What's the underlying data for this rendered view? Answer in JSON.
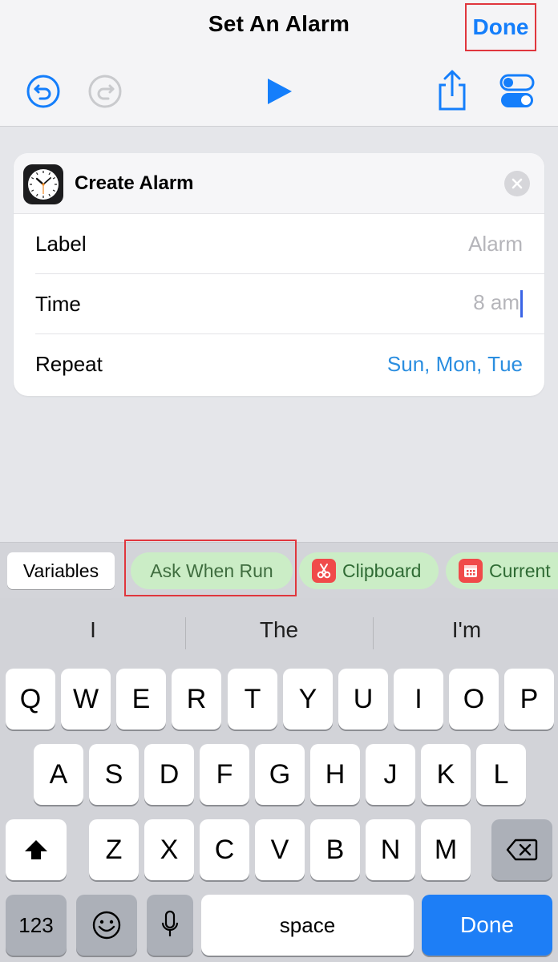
{
  "nav": {
    "title": "Set An Alarm",
    "done_label": "Done"
  },
  "toolbar": {
    "icons": [
      "undo-icon",
      "redo-icon",
      "play-icon",
      "share-icon",
      "settings-toggle-icon"
    ]
  },
  "action": {
    "title": "Create Alarm",
    "icon": "clock-icon",
    "rows": [
      {
        "label": "Label",
        "value": "Alarm"
      },
      {
        "label": "Time",
        "value": "8 am"
      },
      {
        "label": "Repeat",
        "value": "Sun, Mon, Tue"
      }
    ]
  },
  "variables": {
    "variables_label": "Variables",
    "ask_label": "Ask When Run",
    "clipboard_label": "Clipboard",
    "current_label": "Current"
  },
  "keyboard": {
    "suggestions": [
      "I",
      "The",
      "I'm"
    ],
    "row1": [
      "Q",
      "W",
      "E",
      "R",
      "T",
      "Y",
      "U",
      "I",
      "O",
      "P"
    ],
    "row2": [
      "A",
      "S",
      "D",
      "F",
      "G",
      "H",
      "J",
      "K",
      "L"
    ],
    "row3": [
      "Z",
      "X",
      "C",
      "V",
      "B",
      "N",
      "M"
    ],
    "numbers_label": "123",
    "space_label": "space",
    "done_label": "Done"
  },
  "colors": {
    "accent": "#147efb",
    "highlight": "#e0363d",
    "variable_green": "#cbedc6",
    "repeat_value": "#2b8ee0"
  }
}
